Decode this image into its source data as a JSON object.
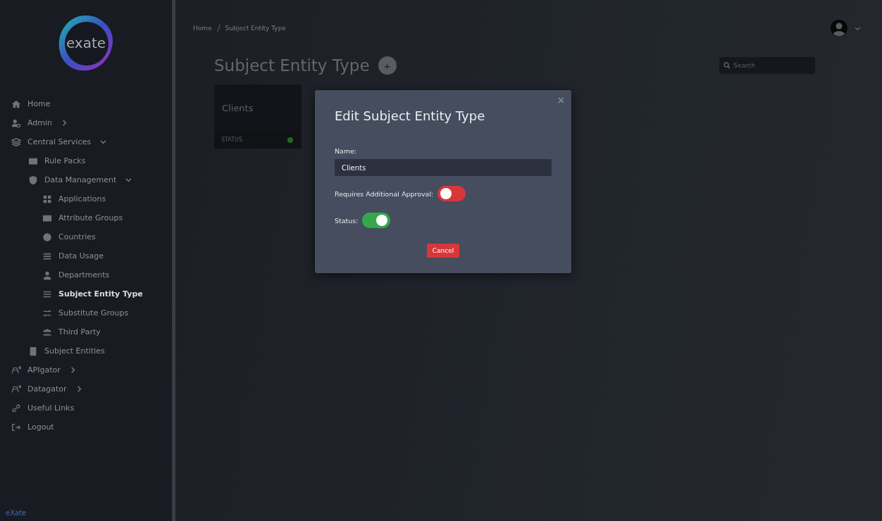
{
  "sidebar": {
    "logo": "exate",
    "items": [
      {
        "label": "Home"
      },
      {
        "label": "Admin",
        "expanded": false
      },
      {
        "label": "Central Services",
        "expanded": true,
        "children": [
          {
            "label": "Rule Packs"
          },
          {
            "label": "Data Management",
            "expanded": true,
            "children": [
              {
                "label": "Applications",
                "selected": false
              },
              {
                "label": "Attribute Groups",
                "selected": false
              },
              {
                "label": "Countries",
                "selected": false
              },
              {
                "label": "Data Usage",
                "selected": false
              },
              {
                "label": "Departments",
                "selected": false
              },
              {
                "label": "Subject Entity Type",
                "selected": true
              },
              {
                "label": "Substitute Groups",
                "selected": false
              },
              {
                "label": "Third Party",
                "selected": false
              }
            ]
          },
          {
            "label": "Subject Entities"
          }
        ]
      },
      {
        "label": "APIgator",
        "expanded": false
      },
      {
        "label": "Datagator",
        "expanded": false
      },
      {
        "label": "Useful Links"
      },
      {
        "label": "Logout"
      }
    ],
    "footer": "eXate"
  },
  "breadcrumb": [
    "Home",
    "Subject Entity Type"
  ],
  "page_title": "Subject Entity Type",
  "add_button": "+",
  "search": {
    "placeholder": "Search"
  },
  "cards": [
    {
      "title": "Clients",
      "status_label": "STATUS",
      "active": true
    }
  ],
  "modal": {
    "title": "Edit Subject Entity Type",
    "close": "×",
    "name_label": "Name:",
    "name_value": "Clients",
    "toggles": [
      {
        "label": "Requires Additional Approval:",
        "on": false
      },
      {
        "label": "Status:",
        "on": true
      }
    ],
    "cancel": "Cancel"
  }
}
